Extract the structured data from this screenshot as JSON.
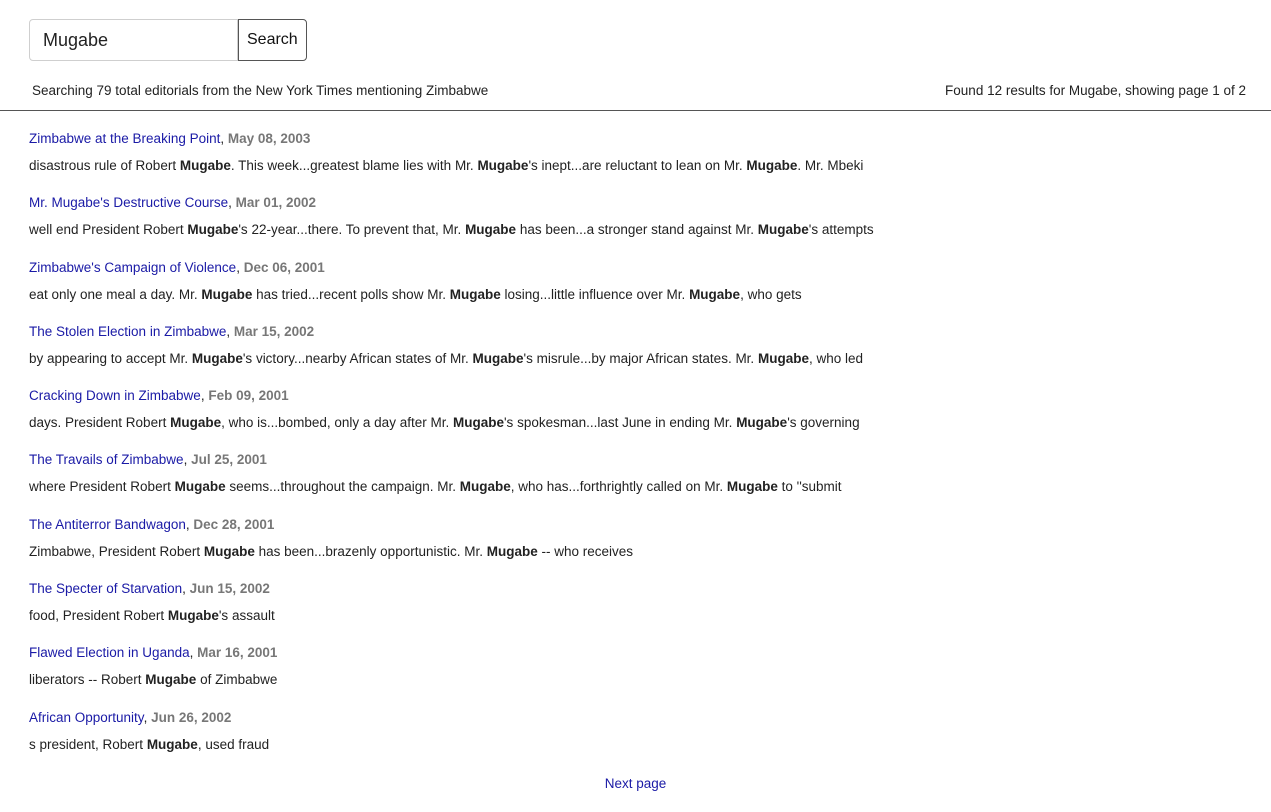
{
  "search": {
    "value": "Mugabe",
    "button_label": "Search"
  },
  "stats": {
    "left": "Searching 79 total editorials from the New York Times mentioning Zimbabwe",
    "right": "Found 12 results for Mugabe, showing page 1 of 2"
  },
  "highlight_term": "Mugabe",
  "results": [
    {
      "title": "Zimbabwe at the Breaking Point",
      "date": "May 08, 2003",
      "snippet": "disastrous rule of Robert Mugabe. This week...greatest blame lies with Mr. Mugabe's inept...are reluctant to lean on Mr. Mugabe. Mr. Mbeki"
    },
    {
      "title": "Mr. Mugabe's Destructive Course",
      "date": "Mar 01, 2002",
      "snippet": "well end President Robert Mugabe's 22-year...there. To prevent that, Mr. Mugabe has been...a stronger stand against Mr. Mugabe's attempts"
    },
    {
      "title": "Zimbabwe's Campaign of Violence",
      "date": "Dec 06, 2001",
      "snippet": "eat only one meal a day. Mr. Mugabe has tried...recent polls show Mr. Mugabe losing...little influence over Mr. Mugabe, who gets"
    },
    {
      "title": "The Stolen Election in Zimbabwe",
      "date": "Mar 15, 2002",
      "snippet": "by appearing to accept Mr. Mugabe's victory...nearby African states of Mr. Mugabe's misrule...by major African states. Mr. Mugabe, who led"
    },
    {
      "title": "Cracking Down in Zimbabwe",
      "date": "Feb 09, 2001",
      "snippet": "days. President Robert Mugabe, who is...bombed, only a day after Mr. Mugabe's spokesman...last June in ending Mr. Mugabe's governing"
    },
    {
      "title": "The Travails of Zimbabwe",
      "date": "Jul 25, 2001",
      "snippet": "where President Robert Mugabe seems...throughout the campaign. Mr. Mugabe, who has...forthrightly called on Mr. Mugabe to ''submit"
    },
    {
      "title": "The Antiterror Bandwagon",
      "date": "Dec 28, 2001",
      "snippet": "Zimbabwe, President Robert Mugabe has been...brazenly opportunistic. Mr. Mugabe -- who receives"
    },
    {
      "title": "The Specter of Starvation",
      "date": "Jun 15, 2002",
      "snippet": "food, President Robert Mugabe's assault"
    },
    {
      "title": "Flawed Election in Uganda",
      "date": "Mar 16, 2001",
      "snippet": "liberators -- Robert Mugabe of Zimbabwe"
    },
    {
      "title": "African Opportunity",
      "date": "Jun 26, 2002",
      "snippet": "s president, Robert Mugabe, used fraud"
    }
  ],
  "pagination": {
    "next_label": "Next page"
  },
  "colors": {
    "link": "#1a1aa6",
    "date": "#777777",
    "text": "#222222",
    "divider": "#555555"
  }
}
